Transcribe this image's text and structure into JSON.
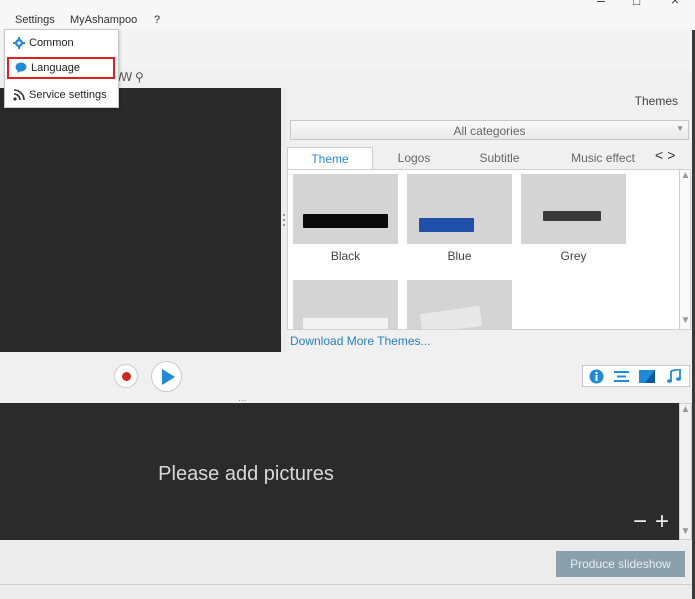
{
  "menubar": {
    "items": [
      "Settings",
      "MyAshampoo",
      "?"
    ],
    "window_controls": {
      "minimize": "–",
      "maximize": "□",
      "close": "×"
    }
  },
  "settings_menu": {
    "items": [
      {
        "label": "Common",
        "icon": "gear-icon"
      },
      {
        "label": "Language",
        "icon": "speech-bubble-icon",
        "highlighted": true
      },
      {
        "label": "Service settings",
        "icon": "rss-icon"
      }
    ]
  },
  "toolbar_row": {
    "glyphs": [
      "ꟿ",
      "⚲"
    ]
  },
  "themes_panel": {
    "title": "Themes",
    "category": {
      "selected": "All categories",
      "arrow": "▼"
    },
    "tabs": [
      "Theme",
      "Logos",
      "Subtitle",
      "Music effect"
    ],
    "active_tab": "Theme",
    "tab_nav": {
      "prev": "<",
      "next": ">"
    },
    "themes": [
      {
        "label": "Black",
        "bar_color": "#0a0a0a"
      },
      {
        "label": "Blue",
        "bar_color": "#1f4fa8"
      },
      {
        "label": "Grey",
        "bar_color": "#3a3a3a"
      },
      {
        "label": "",
        "bar_color": "#f2f2f2"
      },
      {
        "label": "",
        "bar_color": "#e8e8e8"
      }
    ],
    "download_link": "Download More Themes..."
  },
  "transport": {
    "record_color": "#cc2b1c",
    "play_color": "#1e8ad8",
    "grip": "...",
    "icons": [
      {
        "name": "info-icon",
        "glyph": "ℹ"
      },
      {
        "name": "text-align-icon",
        "glyph": "☰"
      },
      {
        "name": "transition-icon",
        "glyph": "◪"
      },
      {
        "name": "music-icon",
        "glyph": "♫"
      }
    ]
  },
  "timeline": {
    "placeholder": "Please add pictures",
    "zoom_out": "−",
    "zoom_in": "+"
  },
  "footer": {
    "produce_button": "Produce slideshow"
  },
  "colors": {
    "accent": "#2a8ad4",
    "dark_panel": "#2a2a2a",
    "highlight_border": "#e02020"
  }
}
